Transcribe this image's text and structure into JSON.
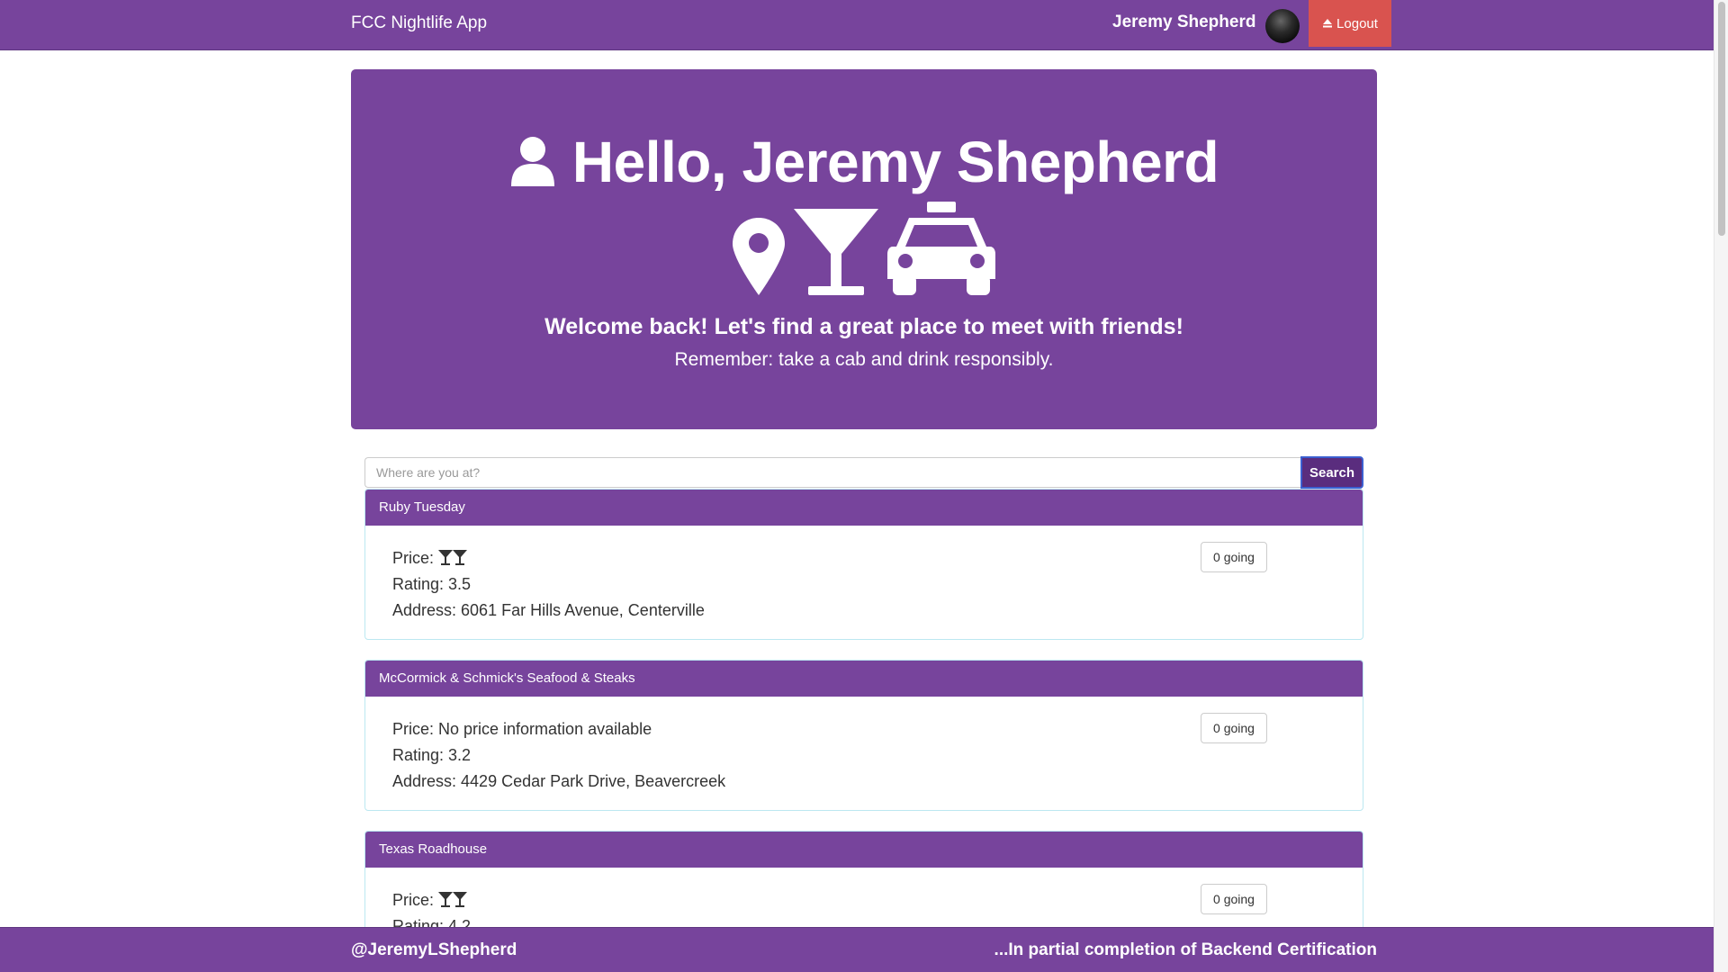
{
  "navbar": {
    "brand": "FCC Nightlife App",
    "user_name": "Jeremy Shepherd",
    "logout_label": "Logout"
  },
  "hero": {
    "greeting": "Hello, Jeremy Shepherd",
    "welcome": "Welcome back! Let's find a great place to meet with friends!",
    "remember": "Remember: take a cab and drink responsibly.",
    "icons": [
      "user-icon",
      "map-marker-icon",
      "cocktail-glass-icon",
      "taxi-icon"
    ]
  },
  "search": {
    "placeholder": "Where are you at?",
    "button_label": "Search"
  },
  "venues": [
    {
      "name": "Ruby Tuesday",
      "price_label": "Price:",
      "price_level": 2,
      "price_text": "",
      "rating": "Rating: 3.5",
      "address": "Address: 6061 Far Hills Avenue, Centerville",
      "going": "0 going"
    },
    {
      "name": "McCormick & Schmick's Seafood & Steaks",
      "price_label": "Price: No price information available",
      "price_level": 0,
      "price_text": "",
      "rating": "Rating: 3.2",
      "address": "Address: 4429 Cedar Park Drive, Beavercreek",
      "going": "0 going"
    },
    {
      "name": "Texas Roadhouse",
      "price_label": "Price:",
      "price_level": 2,
      "price_text": "",
      "rating": "Rating: 4.2",
      "address": "",
      "going": "0 going"
    }
  ],
  "footer": {
    "handle": "@JeremyLShepherd",
    "note": "...In partial completion of Backend Certification"
  },
  "colors": {
    "primary": "#77449c",
    "logout": "#d9534f",
    "panel_border": "#bce8f1"
  }
}
